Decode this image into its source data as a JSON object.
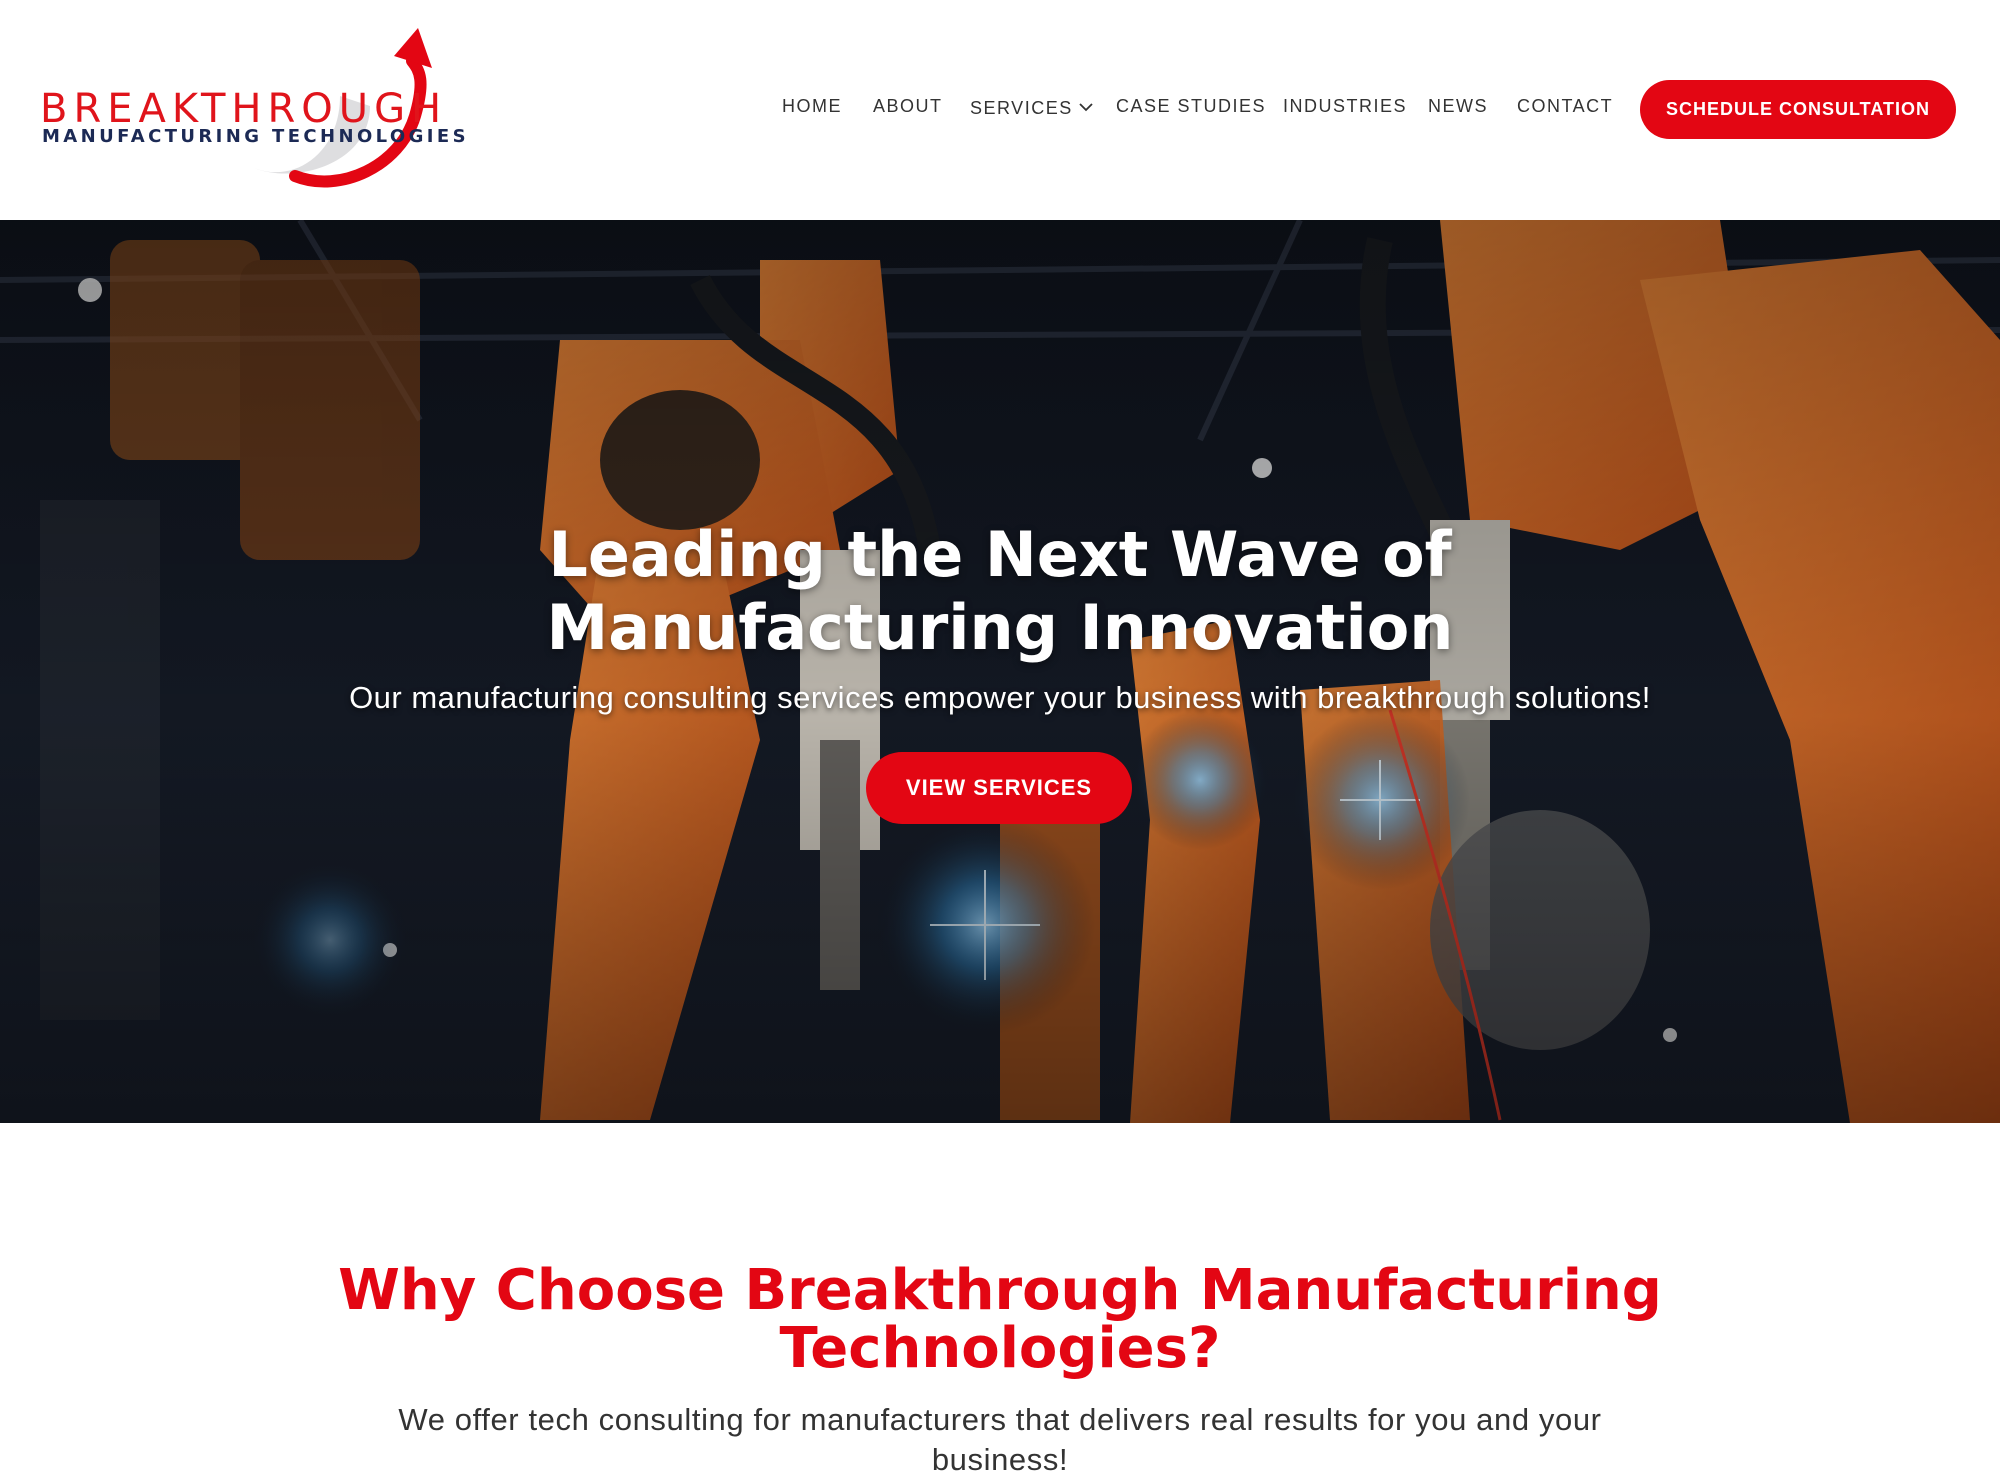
{
  "brand": {
    "name": "BREAKTHROUGH",
    "tagline": "MANUFACTURING TECHNOLOGIES",
    "accent": "#e30613",
    "navy": "#1c2a55"
  },
  "nav": {
    "items": [
      {
        "label": "HOME"
      },
      {
        "label": "ABOUT"
      },
      {
        "label": "SERVICES",
        "icon": "chevron-down-icon"
      },
      {
        "label": "CASE STUDIES"
      },
      {
        "label": "INDUSTRIES"
      },
      {
        "label": "NEWS"
      },
      {
        "label": "CONTACT"
      }
    ],
    "cta_label": "SCHEDULE CONSULTATION"
  },
  "hero": {
    "title": "Leading the Next Wave of Manufacturing Innovation",
    "subtitle": "Our manufacturing consulting services empower your business with breakthrough solutions!",
    "button_label": "VIEW SERVICES"
  },
  "why": {
    "title": "Why Choose Breakthrough Manufacturing Technologies?",
    "text": "We offer tech consulting for manufacturers that delivers real results for you and your business!"
  }
}
